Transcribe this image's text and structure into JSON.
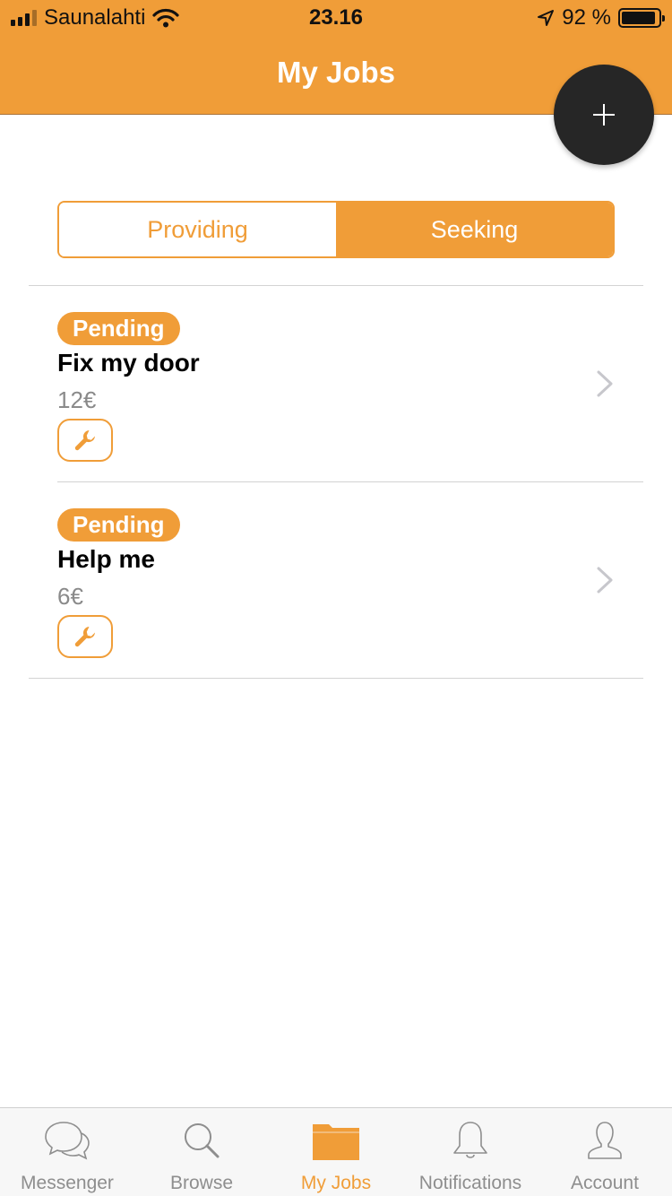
{
  "status_bar": {
    "carrier": "Saunalahti",
    "time": "23.16",
    "battery_text": "92 %",
    "battery_level": 0.92
  },
  "header": {
    "title": "My Jobs",
    "fab_icon": "plus-icon"
  },
  "segments": {
    "providing": "Providing",
    "seeking": "Seeking",
    "selected": "seeking"
  },
  "jobs": [
    {
      "status": "Pending",
      "title": "Fix my door",
      "price": "12€",
      "icon": "wrench-icon"
    },
    {
      "status": "Pending",
      "title": "Help me",
      "price": "6€",
      "icon": "wrench-icon"
    }
  ],
  "tabbar": {
    "items": [
      {
        "label": "Messenger",
        "icon": "chat-bubbles-icon"
      },
      {
        "label": "Browse",
        "icon": "search-icon"
      },
      {
        "label": "My Jobs",
        "icon": "folder-icon",
        "active": true
      },
      {
        "label": "Notifications",
        "icon": "bell-icon"
      },
      {
        "label": "Account",
        "icon": "person-icon"
      }
    ]
  },
  "colors": {
    "accent": "#f09d38",
    "fab": "#262626",
    "inactive_tab": "#8e8e8e"
  }
}
